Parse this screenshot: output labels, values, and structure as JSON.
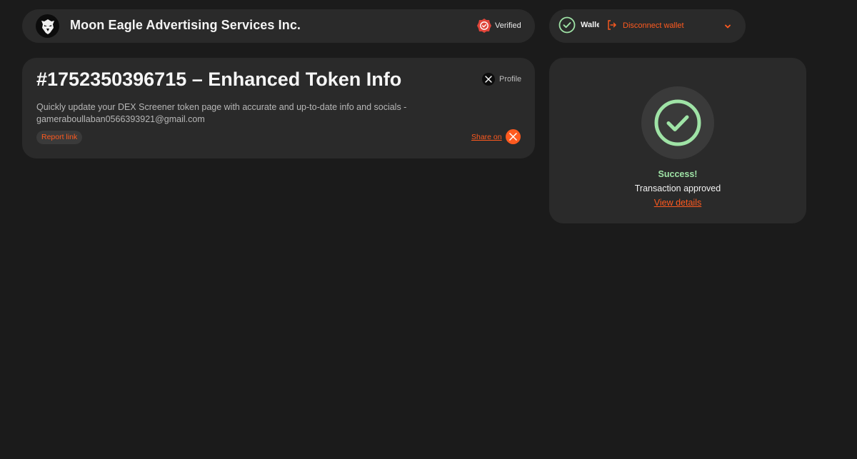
{
  "header": {
    "company_name": "Moon Eagle Advertising Services Inc.",
    "verified_label": "Verified",
    "logo_icon": "eagle-logo-icon",
    "verified_icon": "verified-badge-icon"
  },
  "wallet": {
    "label": "Wallet",
    "disconnect_label": "Disconnect wallet",
    "check_icon": "check-circle-icon",
    "disconnect_icon": "logout-icon",
    "chevron_icon": "chevron-down-icon"
  },
  "token_info": {
    "title": "#1752350396715 – Enhanced Token Info",
    "profile_label": "Profile",
    "description": "Quickly update your DEX Screener token page with accurate and up-to-date info and socials - gameraboullaban0566393921@gmail.com",
    "report_label": "Report link",
    "share_label": "Share on",
    "x_icon": "x-logo-icon"
  },
  "success": {
    "title": "Success!",
    "subtitle": "Transaction approved",
    "link_label": "View details",
    "icon": "check-circle-icon"
  },
  "colors": {
    "background": "#1b1b1b",
    "card": "#2a2a2a",
    "accent": "#ff5a1f",
    "success": "#9fe3a6"
  }
}
